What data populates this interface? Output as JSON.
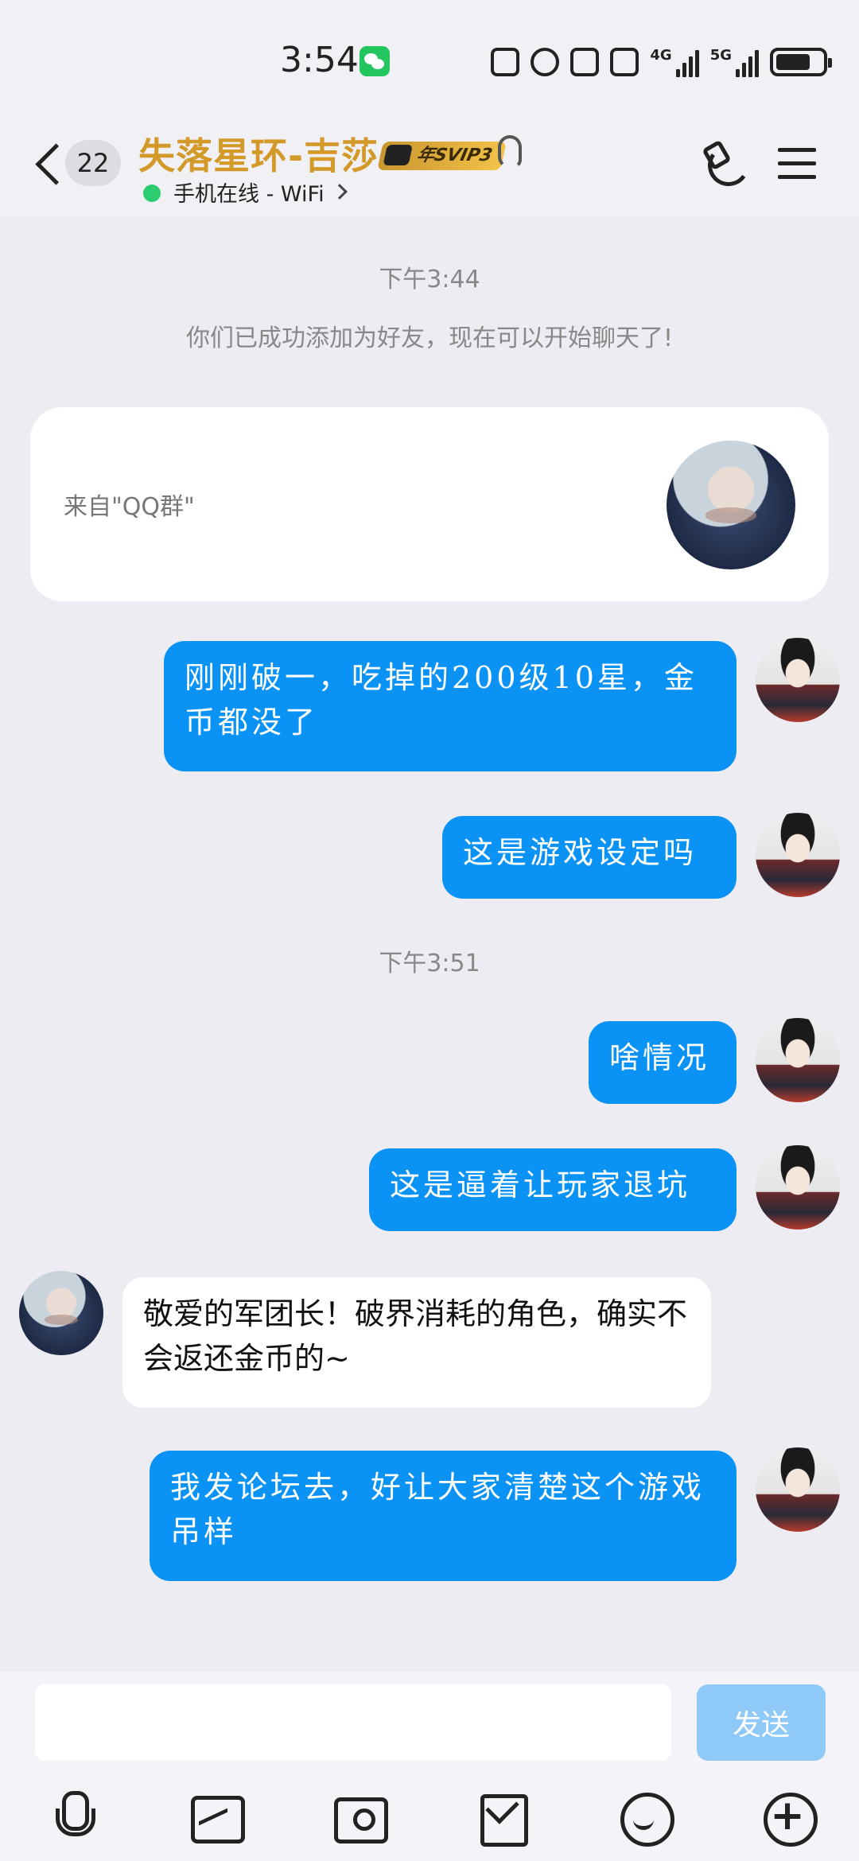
{
  "status_bar": {
    "time": "3:54",
    "network_1": "4G",
    "network_2": "5G",
    "icons": [
      "wechat-icon",
      "nfc-icon",
      "alarm-icon",
      "bluetooth-icon",
      "vibrate-icon",
      "signal-4g-icon",
      "signal-5g-icon",
      "battery-icon"
    ]
  },
  "header": {
    "unread_count": "22",
    "contact_name": "失落星环-吉莎",
    "vip_badge": "年SVIP3",
    "online_status": "手机在线 - WiFi",
    "accent_color": "#d39a2a"
  },
  "chat": {
    "time_1": "下午3:44",
    "system_message": "你们已成功添加为好友，现在可以开始聊天了!",
    "card_label": "来自\"QQ群\"",
    "time_2": "下午3:51",
    "messages": [
      {
        "sender": "me",
        "text": "刚刚破一，吃掉的200级10星，金币都没了"
      },
      {
        "sender": "me",
        "text": "这是游戏设定吗"
      },
      {
        "sender": "me",
        "text": "啥情况"
      },
      {
        "sender": "me",
        "text": "这是逼着让玩家退坑"
      },
      {
        "sender": "them",
        "text": "敬爱的军团长！破界消耗的角色，确实不会返还金币的~"
      },
      {
        "sender": "me",
        "text": "我发论坛去，好让大家清楚这个游戏吊样"
      }
    ],
    "bubble_me_color": "#0a93f5"
  },
  "input": {
    "value": "",
    "send_label": "发送"
  },
  "toolbar": {
    "icons": [
      "microphone-icon",
      "image-icon",
      "camera-icon",
      "red-packet-icon",
      "emoji-icon",
      "plus-icon"
    ]
  }
}
